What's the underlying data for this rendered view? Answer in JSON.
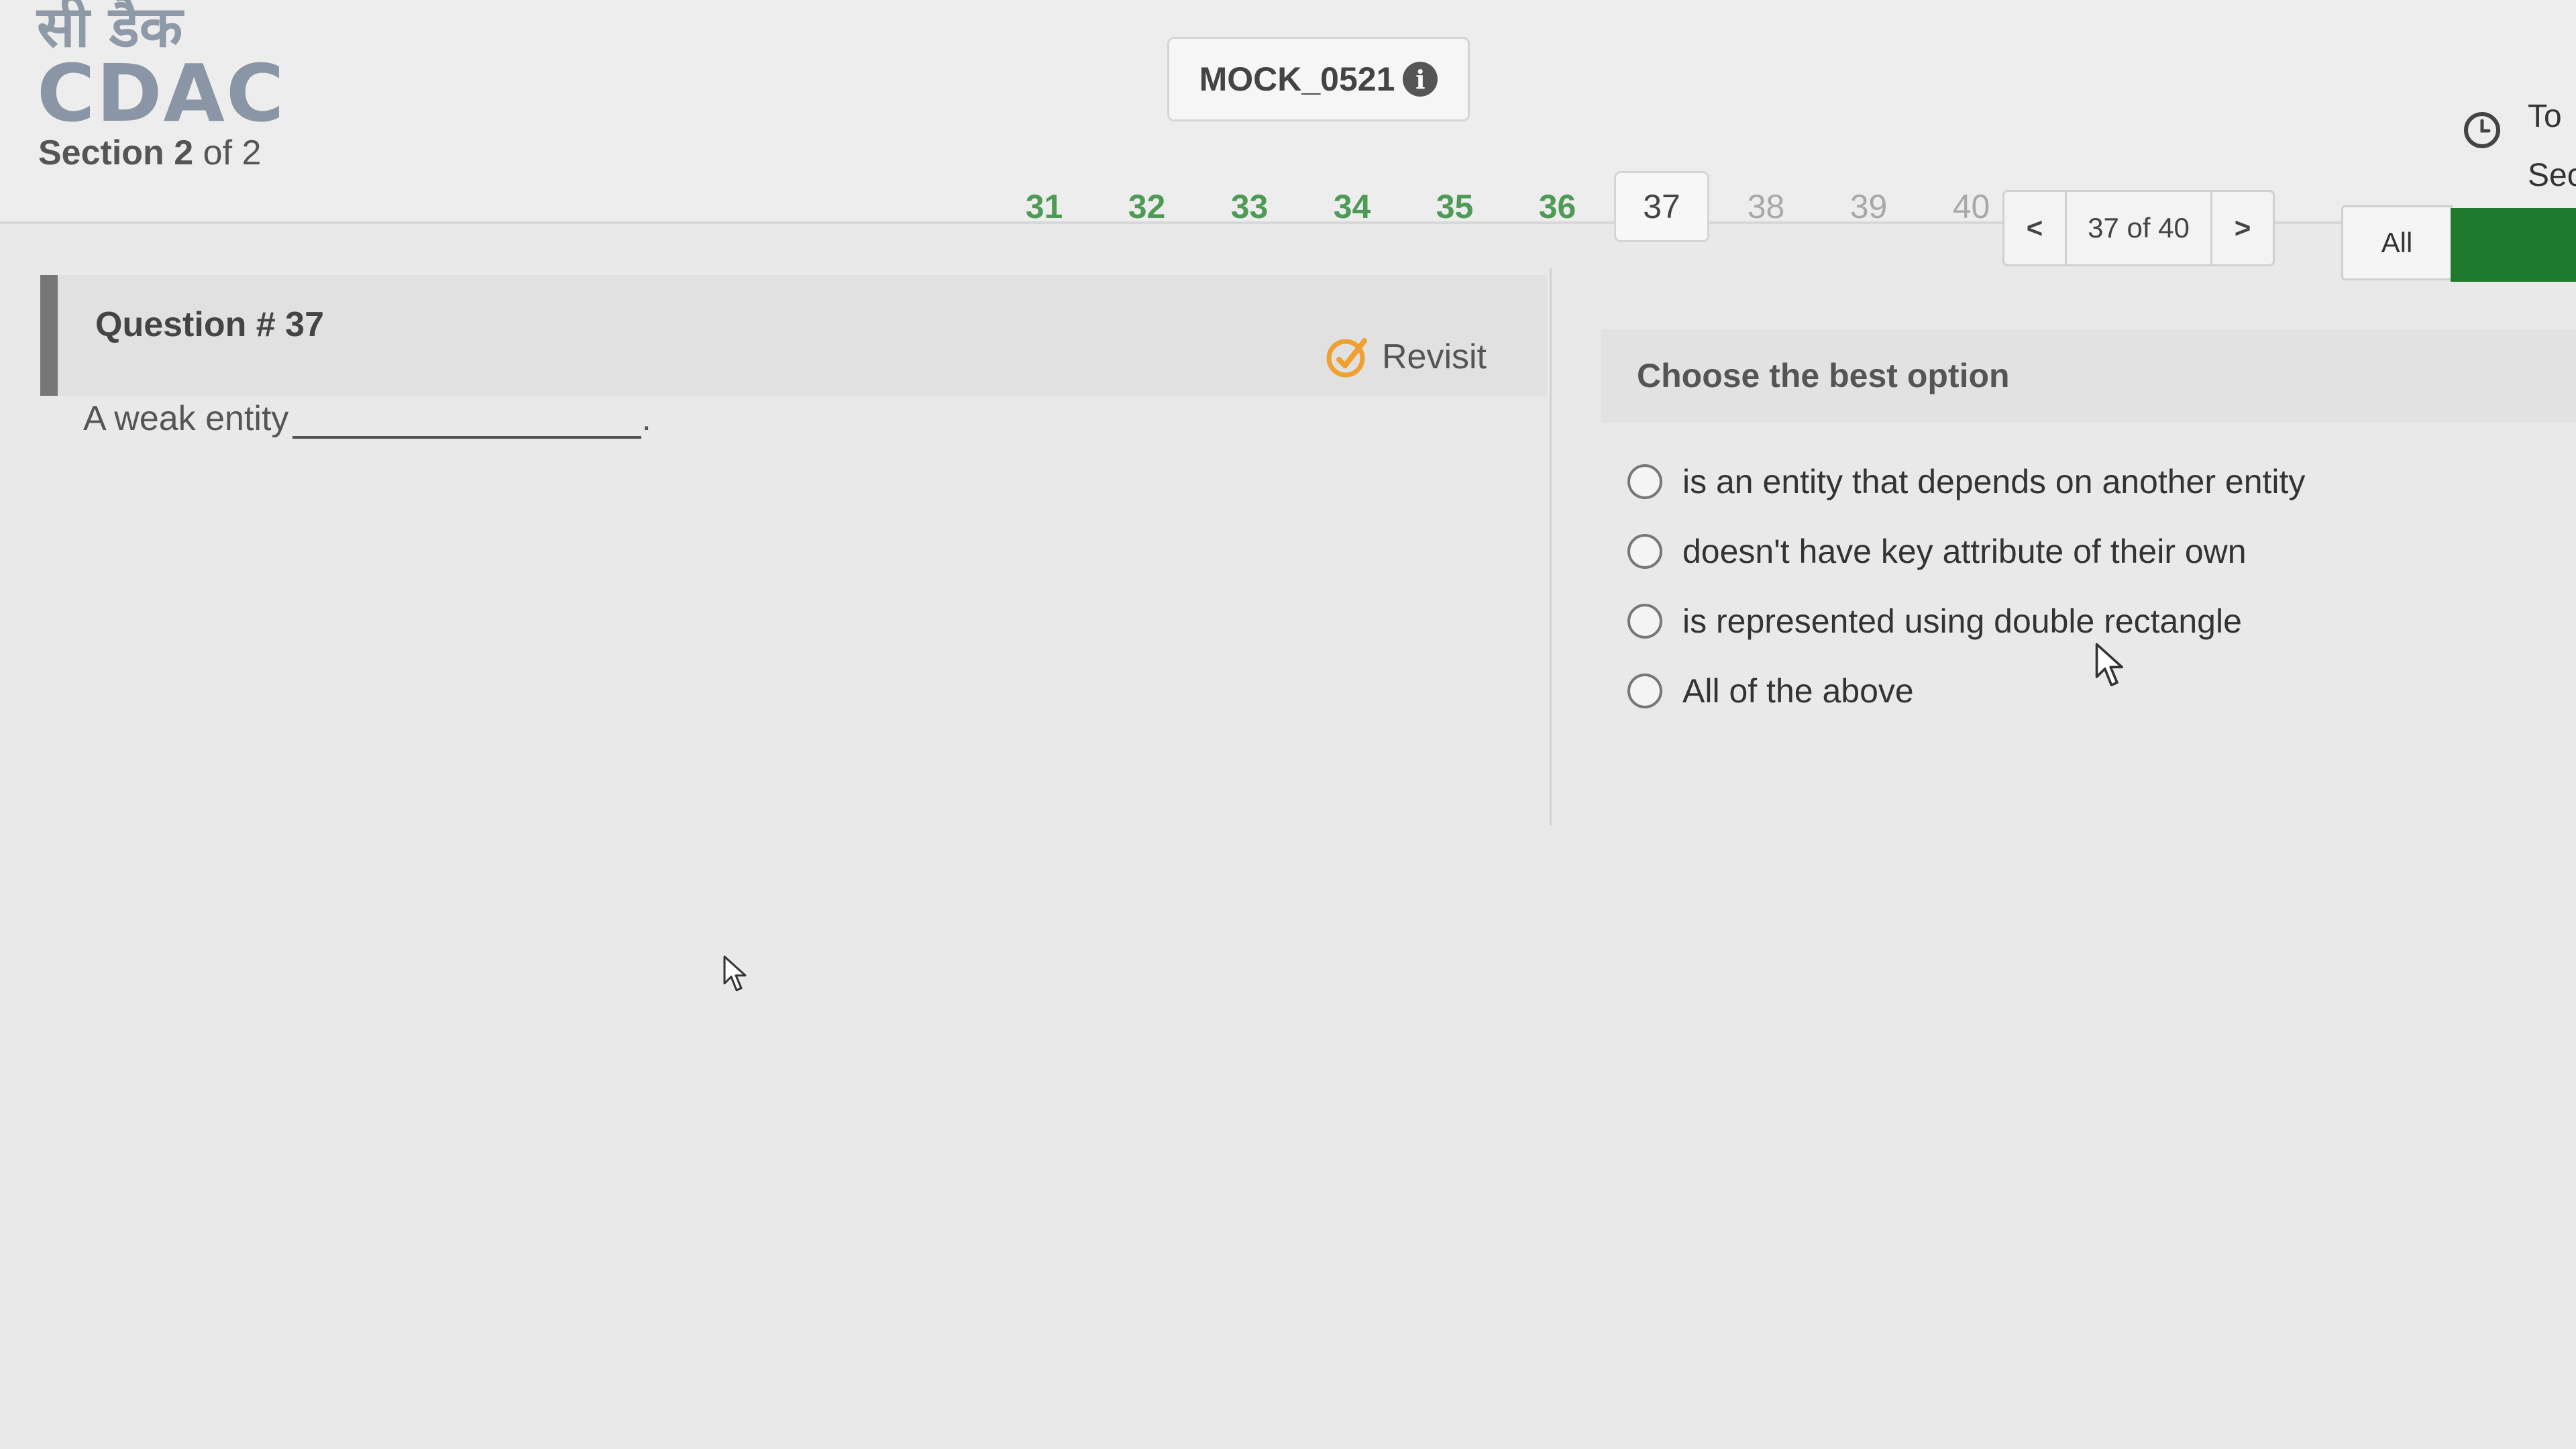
{
  "header": {
    "logo_hindi": "सी डैक",
    "logo_text": "CDAC",
    "section_prefix": "Section",
    "section_current": "2",
    "section_suffix": "of 2",
    "mock_title": "MOCK_0521",
    "info_icon": "i",
    "timer_icon": "clock-icon",
    "timer_text_line1": "To",
    "timer_text_line2": "Sec"
  },
  "navigation": {
    "visited_numbers": [
      "31",
      "32",
      "33",
      "34",
      "35",
      "36"
    ],
    "current_number": "37",
    "unvisited_numbers": [
      "38",
      "39",
      "40"
    ],
    "prev_label": "<",
    "page_count": "37 of 40",
    "next_label": ">",
    "filter_label": "All",
    "colors": {
      "visited": "#4f9a57",
      "unvisited": "#a8a8a8",
      "green_button": "#1e7a2c"
    }
  },
  "question": {
    "title": "Question # 37",
    "revisit_label": "Revisit",
    "text": "A weak entity",
    "text_end": "."
  },
  "answer": {
    "prompt": "Choose the best option",
    "options": [
      "is an entity that depends on another entity",
      "doesn't  have key attribute of their own",
      "is represented using double rectangle",
      "All of the above"
    ]
  }
}
